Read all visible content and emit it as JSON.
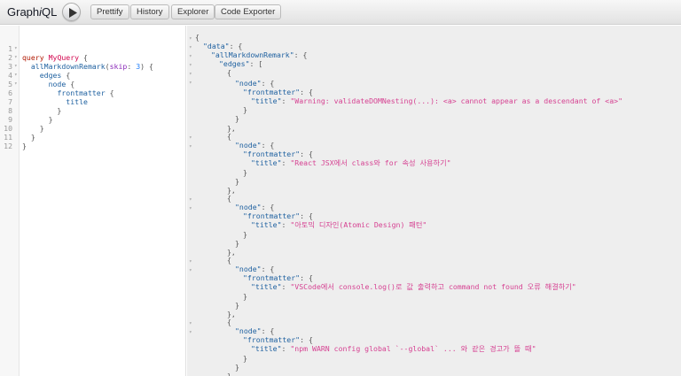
{
  "toolbar": {
    "logo_prefix": "Graph",
    "logo_i": "i",
    "logo_suffix": "QL",
    "prettify": "Prettify",
    "history": "History",
    "explorer": "Explorer",
    "code_exporter": "Code Exporter"
  },
  "query": {
    "line_numbers": [
      "1",
      "2",
      "3",
      "4",
      "5",
      "6",
      "7",
      "8",
      "9",
      "10",
      "11",
      "12"
    ],
    "keyword_query": "query",
    "operation_name": "MyQuery",
    "root_field": "allMarkdownRemark",
    "arg_name": "skip",
    "arg_value": "3",
    "edges": "edges",
    "node": "node",
    "frontmatter": "frontmatter",
    "title": "title"
  },
  "result": {
    "keys": {
      "data": "\"data\"",
      "root": "\"allMarkdownRemark\"",
      "edges": "\"edges\"",
      "node": "\"node\"",
      "frontmatter": "\"frontmatter\"",
      "title": "\"title\""
    },
    "titles": [
      "\"Warning: validateDOMNesting(...): <a> cannot appear as a descendant of <a>\"",
      "\"React JSX에서 class와 for 속성 사용하기\"",
      "\"아토믹 디자인(Atomic Design) 패턴\"",
      "\"VSCode에서 console.log()로 값 출력하고 command not found 오류 해결하기\"",
      "\"npm WARN config global `--global` ... 와 같은 경고가 뜰 때\""
    ]
  }
}
